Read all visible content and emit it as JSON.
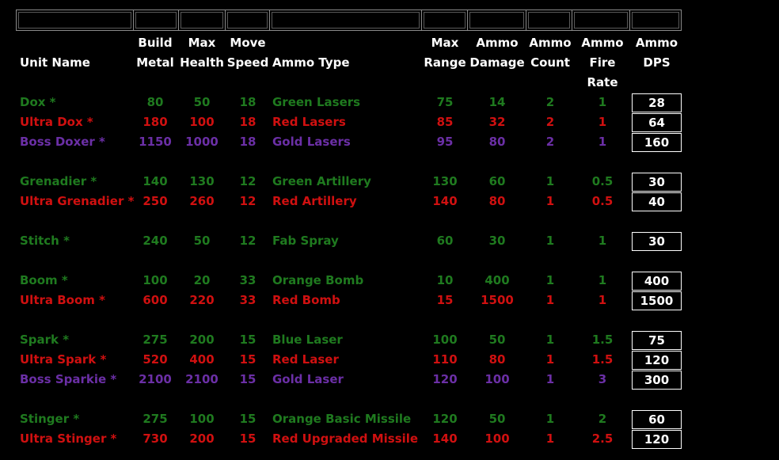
{
  "colors": {
    "green": "#1f7a1f",
    "red": "#d01010",
    "purple": "#6b2fa6",
    "white": "#ffffff",
    "background": "#000000"
  },
  "headers": {
    "unit_name": [
      "",
      "Unit Name"
    ],
    "build_metal": [
      "Build",
      "Metal"
    ],
    "max_health": [
      "Max",
      "Health"
    ],
    "move_speed": [
      "Move",
      "Speed"
    ],
    "ammo_type": [
      "",
      "Ammo Type"
    ],
    "max_range": [
      "Max",
      "Range"
    ],
    "ammo_damage": [
      "Ammo",
      "Damage"
    ],
    "ammo_count": [
      "Ammo",
      "Count"
    ],
    "ammo_fire_rate": [
      "Ammo",
      "Fire Rate"
    ],
    "ammo_dps": [
      "Ammo",
      "DPS"
    ]
  },
  "rows": [
    {
      "name": "Dox *",
      "metal": "80",
      "health": "50",
      "speed": "18",
      "ammo": "Green Lasers",
      "range": "75",
      "damage": "14",
      "count": "2",
      "rate": "1",
      "dps": "28",
      "color": "green"
    },
    {
      "name": "Ultra Dox *",
      "metal": "180",
      "health": "100",
      "speed": "18",
      "ammo": "Red Lasers",
      "range": "85",
      "damage": "32",
      "count": "2",
      "rate": "1",
      "dps": "64",
      "color": "red"
    },
    {
      "name": "Boss Doxer *",
      "metal": "1150",
      "health": "1000",
      "speed": "18",
      "ammo": "Gold Lasers",
      "range": "95",
      "damage": "80",
      "count": "2",
      "rate": "1",
      "dps": "160",
      "color": "purple"
    },
    {
      "name": "Grenadier *",
      "metal": "140",
      "health": "130",
      "speed": "12",
      "ammo": "Green Artillery",
      "range": "130",
      "damage": "60",
      "count": "1",
      "rate": "0.5",
      "dps": "30",
      "color": "green"
    },
    {
      "name": "Ultra Grenadier *",
      "metal": "250",
      "health": "260",
      "speed": "12",
      "ammo": "Red Artillery",
      "range": "140",
      "damage": "80",
      "count": "1",
      "rate": "0.5",
      "dps": "40",
      "color": "red"
    },
    {
      "name": "Stitch *",
      "metal": "240",
      "health": "50",
      "speed": "12",
      "ammo": "Fab Spray",
      "range": "60",
      "damage": "30",
      "count": "1",
      "rate": "1",
      "dps": "30",
      "color": "green"
    },
    {
      "name": "Boom *",
      "metal": "100",
      "health": "20",
      "speed": "33",
      "ammo": "Orange Bomb",
      "range": "10",
      "damage": "400",
      "count": "1",
      "rate": "1",
      "dps": "400",
      "color": "green"
    },
    {
      "name": "Ultra Boom *",
      "metal": "600",
      "health": "220",
      "speed": "33",
      "ammo": "Red Bomb",
      "range": "15",
      "damage": "1500",
      "count": "1",
      "rate": "1",
      "dps": "1500",
      "color": "red"
    },
    {
      "name": "Spark *",
      "metal": "275",
      "health": "200",
      "speed": "15",
      "ammo": "Blue Laser",
      "range": "100",
      "damage": "50",
      "count": "1",
      "rate": "1.5",
      "dps": "75",
      "color": "green"
    },
    {
      "name": "Ultra Spark *",
      "metal": "520",
      "health": "400",
      "speed": "15",
      "ammo": "Red Laser",
      "range": "110",
      "damage": "80",
      "count": "1",
      "rate": "1.5",
      "dps": "120",
      "color": "red"
    },
    {
      "name": "Boss Sparkie *",
      "metal": "2100",
      "health": "2100",
      "speed": "15",
      "ammo": "Gold Laser",
      "range": "120",
      "damage": "100",
      "count": "1",
      "rate": "3",
      "dps": "300",
      "color": "purple"
    },
    {
      "name": "Stinger *",
      "metal": "275",
      "health": "100",
      "speed": "15",
      "ammo": "Orange Basic Missile",
      "range": "120",
      "damage": "50",
      "count": "1",
      "rate": "2",
      "dps": "60",
      "color": "green"
    },
    {
      "name": "Ultra Stinger *",
      "metal": "730",
      "health": "200",
      "speed": "15",
      "ammo": "Red Upgraded Missile",
      "range": "140",
      "damage": "100",
      "count": "1",
      "rate": "2.5",
      "dps": "120",
      "color": "red"
    }
  ]
}
